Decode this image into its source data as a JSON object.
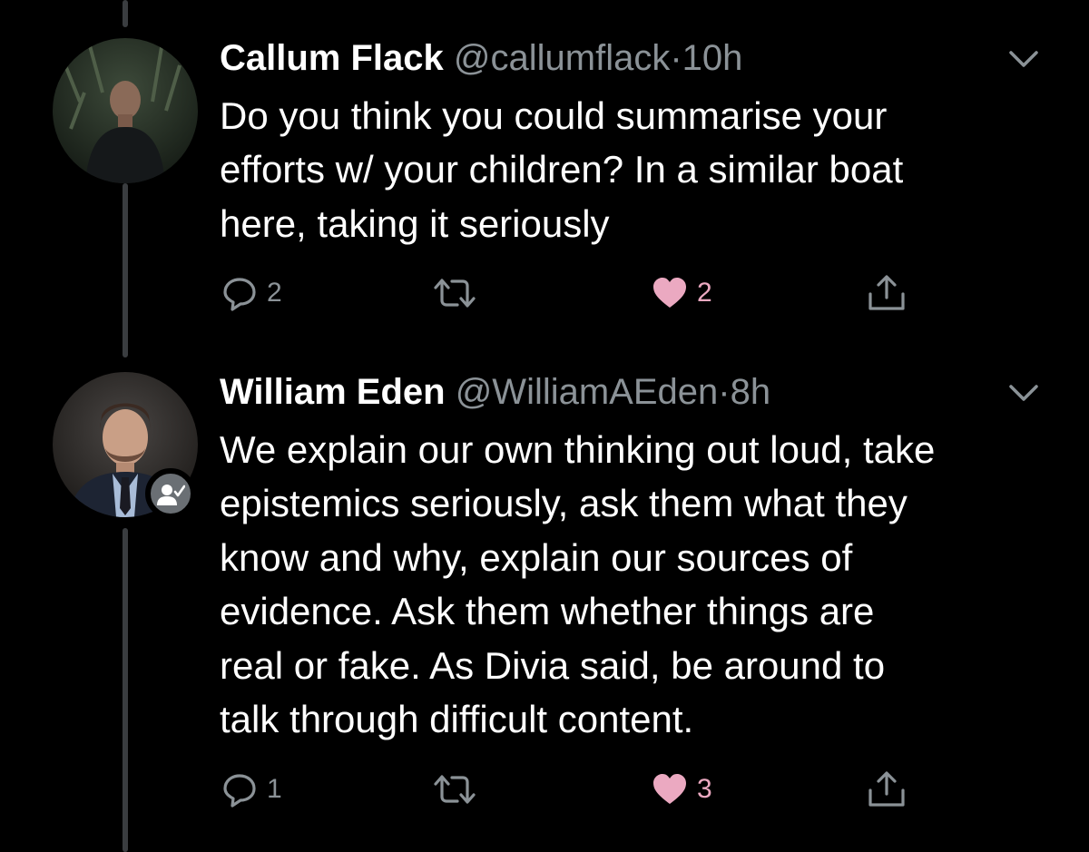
{
  "tweets": [
    {
      "name": "Callum Flack",
      "handle": "@callumflack",
      "separator": "·",
      "time": "10h",
      "body_lines": [
        "Do you think you could summarise your",
        "efforts w/ your children? In a similar boat",
        "here, taking it seriously"
      ],
      "reply_count": "2",
      "like_count": "2",
      "liked": true,
      "avatar_icon": "profile-photo"
    },
    {
      "name": "William Eden",
      "handle": "@WilliamAEden",
      "separator": "·",
      "time": "8h",
      "body_lines": [
        "We explain our own thinking out loud, take",
        "epistemics seriously, ask them what they",
        "know and why, explain our sources of",
        "evidence. Ask them whether things are",
        "real or fake. As Divia said, be around to",
        "talk through difficult content."
      ],
      "reply_count": "1",
      "like_count": "3",
      "liked": true,
      "avatar_icon": "profile-photo",
      "badge_icon": "follows-you-icon"
    }
  ],
  "colors": {
    "background": "#000000",
    "text": "#ffffff",
    "muted": "#8b9297",
    "like": "#eba9c1",
    "thread_line": "#3a3d40"
  },
  "icons": [
    "reply-icon",
    "retweet-icon",
    "heart-icon",
    "share-icon",
    "chevron-down-icon"
  ]
}
